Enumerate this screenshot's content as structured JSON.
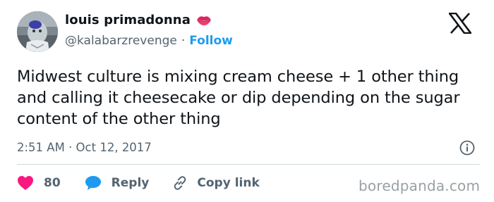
{
  "author": {
    "display_name": "louis primadonna",
    "handle": "@kalabarzrevenge",
    "separator": "·",
    "follow_label": "Follow"
  },
  "icons": {
    "name_emoji": "lips-icon",
    "platform": "x-logo-icon",
    "info": "info-icon",
    "like": "heart-icon",
    "reply": "speech-bubble-icon",
    "copy": "link-icon"
  },
  "tweet": {
    "text": "Midwest culture is mixing cream cheese + 1 other thing and calling it cheesecake or dip depending on the sugar content of the other thing",
    "timestamp": "2:51 AM · Oct 12, 2017"
  },
  "actions": {
    "like_count": "80",
    "reply_label": "Reply",
    "copy_label": "Copy link"
  },
  "watermark": "boredpanda.com",
  "colors": {
    "like": "#f91880",
    "reply": "#1d9bf0",
    "follow": "#1d9bf0",
    "secondary_text": "#536471",
    "divider": "#cfd9de"
  }
}
